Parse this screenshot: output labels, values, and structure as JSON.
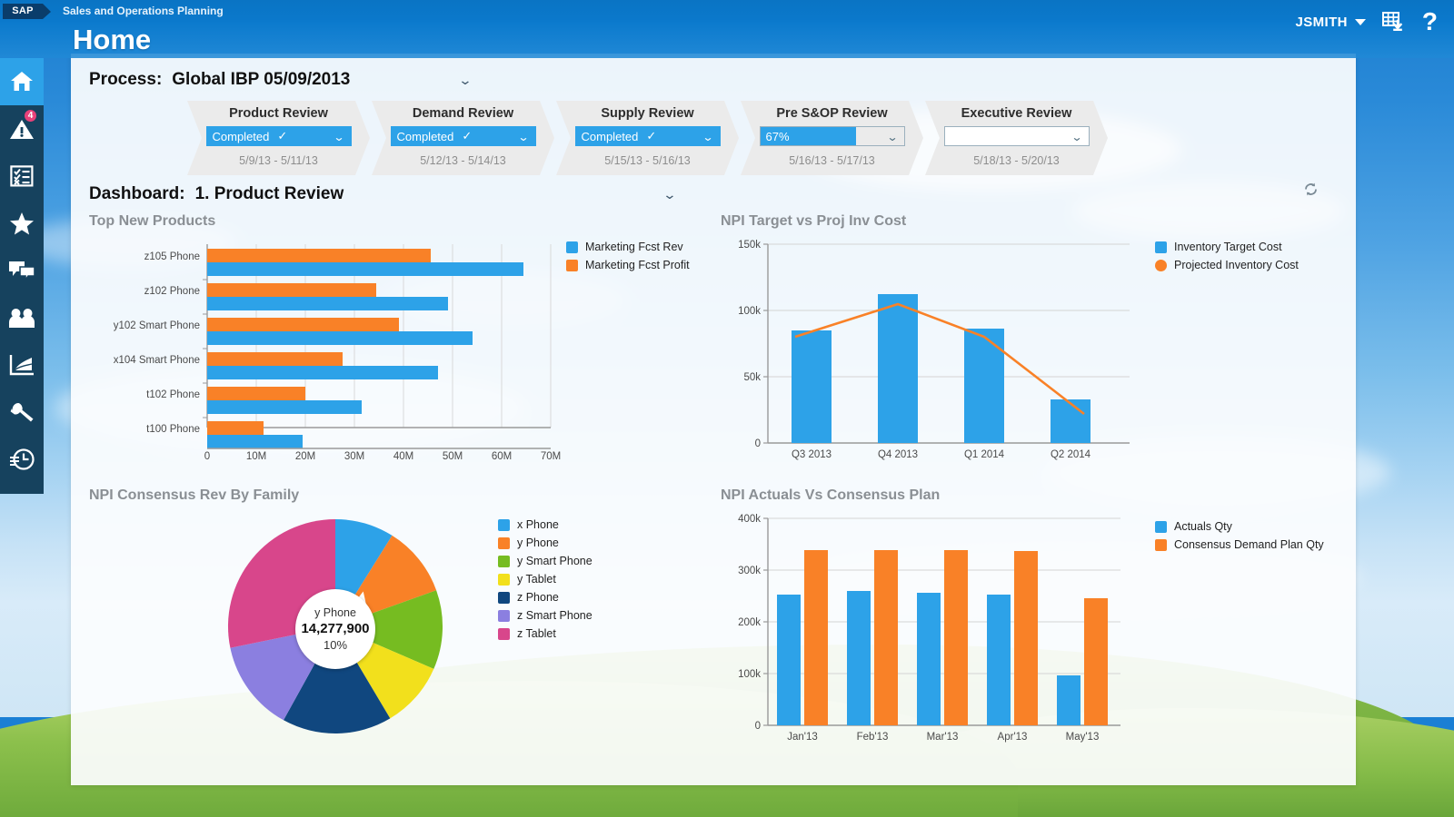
{
  "app": {
    "logo_text": "SAP",
    "title": "Sales and Operations Planning",
    "page_heading": "Home",
    "user": "JSMITH",
    "help_symbol": "?"
  },
  "sidebar": {
    "items": [
      {
        "name": "home-icon",
        "label": "Home",
        "active": true,
        "badge": ""
      },
      {
        "name": "alerts-icon",
        "label": "Alerts",
        "active": false,
        "badge": "4"
      },
      {
        "name": "tasks-icon",
        "label": "Tasks",
        "active": false,
        "badge": ""
      },
      {
        "name": "favorites-icon",
        "label": "Favorites",
        "active": false,
        "badge": ""
      },
      {
        "name": "chat-icon",
        "label": "Collaboration",
        "active": false,
        "badge": ""
      },
      {
        "name": "people-icon",
        "label": "People",
        "active": false,
        "badge": ""
      },
      {
        "name": "analytics-icon",
        "label": "Analytics",
        "active": false,
        "badge": ""
      },
      {
        "name": "configure-icon",
        "label": "Configuration",
        "active": false,
        "badge": ""
      },
      {
        "name": "history-icon",
        "label": "History",
        "active": false,
        "badge": ""
      }
    ]
  },
  "process": {
    "label": "Process:",
    "value": "Global IBP 05/09/2013",
    "stages": [
      {
        "title": "Product Review",
        "status": "Completed",
        "type": "done",
        "dates": "5/9/13 - 5/11/13",
        "fill": 100
      },
      {
        "title": "Demand Review",
        "status": "Completed",
        "type": "done",
        "dates": "5/12/13 - 5/14/13",
        "fill": 100
      },
      {
        "title": "Supply Review",
        "status": "Completed",
        "type": "done",
        "dates": "5/15/13 - 5/16/13",
        "fill": 100
      },
      {
        "title": "Pre S&OP Review",
        "status": "67%",
        "type": "pct",
        "dates": "5/16/13 - 5/17/13",
        "fill": 67
      },
      {
        "title": "Executive Review",
        "status": "",
        "type": "empty",
        "dates": "5/18/13 - 5/20/13",
        "fill": 0
      }
    ]
  },
  "dashboard": {
    "label": "Dashboard:",
    "value": "1. Product Review"
  },
  "colors": {
    "blue": "#2da2e8",
    "orange": "#f98127",
    "green": "#76bc21",
    "yellow": "#f2e01c",
    "navy": "#10477f",
    "purple": "#8b7fe0",
    "pink": "#d8468b",
    "header_blue": "#0b7acd",
    "sidebar": "#16425e",
    "badge": "#e8417a"
  },
  "chart_data": [
    {
      "id": "top-new-products",
      "type": "bar",
      "orientation": "horizontal",
      "title": "Top New Products",
      "categories": [
        "z105 Phone",
        "z102 Phone",
        "y102 Smart Phone",
        "x104 Smart Phone",
        "t102 Phone",
        "t100 Phone"
      ],
      "series": [
        {
          "name": "Marketing Fcst Rev",
          "color": "#2da2e8",
          "values": [
            64500000,
            49000000,
            54000000,
            47000000,
            31500000,
            19500000
          ]
        },
        {
          "name": "Marketing Fcst Profit",
          "color": "#f98127",
          "values": [
            45500000,
            34500000,
            39000000,
            27500000,
            20000000,
            11500000
          ]
        }
      ],
      "xlabel": "",
      "ylabel": "",
      "xlim": [
        0,
        70000000
      ],
      "xticks": [
        "0",
        "10M",
        "20M",
        "30M",
        "40M",
        "50M",
        "60M",
        "70M"
      ],
      "grid": true,
      "legend_position": "right"
    },
    {
      "id": "npi-target-vs-proj-inv-cost",
      "type": "bar",
      "orientation": "vertical",
      "title": "NPI Target vs Proj Inv Cost",
      "categories": [
        "Q3 2013",
        "Q4 2013",
        "Q1 2014",
        "Q2 2014"
      ],
      "series": [
        {
          "name": "Inventory Target Cost",
          "color": "#2da2e8",
          "kind": "bar",
          "values": [
            85000,
            112000,
            86000,
            33000
          ]
        },
        {
          "name": "Projected Inventory Cost",
          "color": "#f98127",
          "kind": "line",
          "values": [
            80000,
            105000,
            80000,
            22000
          ]
        }
      ],
      "xlabel": "",
      "ylabel": "",
      "ylim": [
        0,
        150000
      ],
      "yticks": [
        "0",
        "50k",
        "100k",
        "150k"
      ],
      "grid": true,
      "legend_position": "right"
    },
    {
      "id": "npi-consensus-rev-by-family",
      "type": "pie",
      "title": "NPI Consensus Rev By Family",
      "labels": [
        "x Phone",
        "y Phone",
        "y Smart Phone",
        "y Tablet",
        "z Phone",
        "z Smart Phone",
        "z Tablet"
      ],
      "colors": [
        "#2da2e8",
        "#f98127",
        "#76bc21",
        "#f2e01c",
        "#10477f",
        "#8b7fe0",
        "#d8468b"
      ],
      "values": [
        9,
        10,
        16,
        12,
        17,
        16,
        20
      ],
      "callout": {
        "name": "y Phone",
        "value": "14,277,900",
        "percent": "10%"
      },
      "legend_position": "right"
    },
    {
      "id": "npi-actuals-vs-consensus-plan",
      "type": "bar",
      "orientation": "vertical",
      "title": "NPI Actuals Vs Consensus Plan",
      "categories": [
        "Jan'13",
        "Feb'13",
        "Mar'13",
        "Apr'13",
        "May'13"
      ],
      "series": [
        {
          "name": "Actuals Qty",
          "color": "#2da2e8",
          "values": [
            253000,
            260000,
            257000,
            253000,
            97000
          ]
        },
        {
          "name": "Consensus Demand Plan Qty",
          "color": "#f98127",
          "values": [
            338000,
            338000,
            338000,
            337000,
            246000
          ]
        }
      ],
      "xlabel": "",
      "ylabel": "",
      "ylim": [
        0,
        400000
      ],
      "yticks": [
        "0",
        "100k",
        "200k",
        "300k",
        "400k"
      ],
      "grid": true,
      "legend_position": "right"
    }
  ]
}
